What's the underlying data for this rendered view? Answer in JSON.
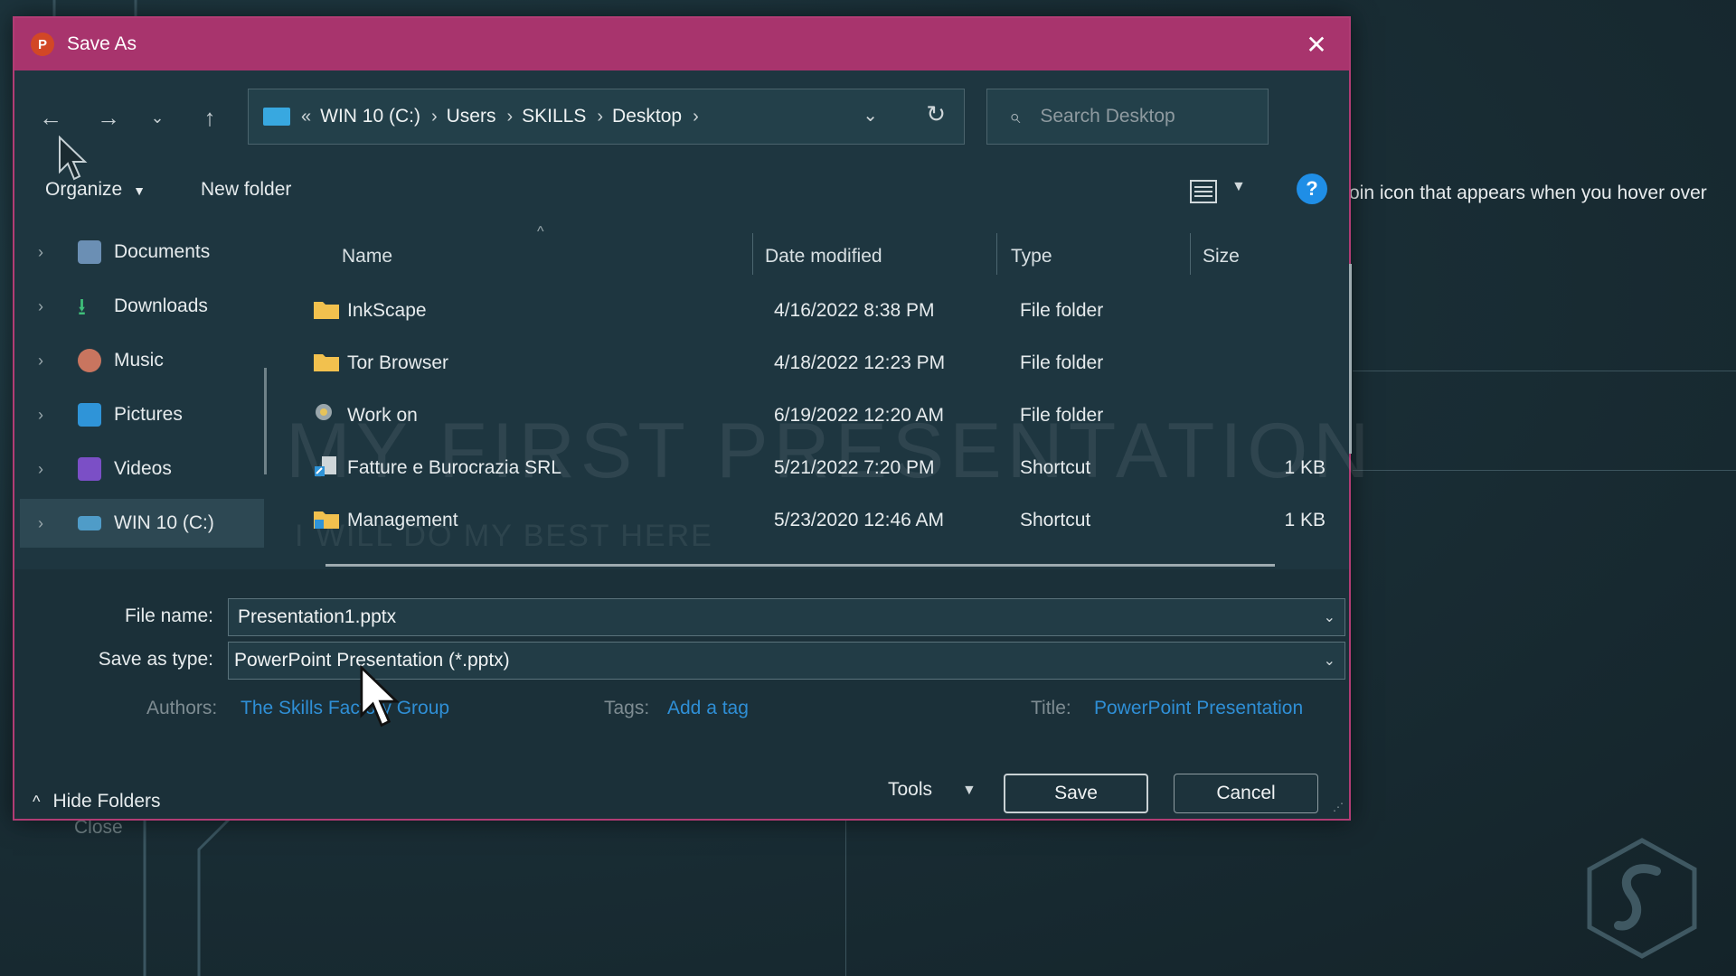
{
  "background": {
    "side_text": "oin icon that appears when you hover over",
    "close_label": "Close"
  },
  "dialog": {
    "title": "Save As",
    "app_icon_letter": "P",
    "accent": "#a8346d"
  },
  "address": {
    "root_chevrons": "«",
    "crumbs": [
      "WIN 10 (C:)",
      "Users",
      "SKILLS",
      "Desktop"
    ],
    "separator": "›"
  },
  "search": {
    "placeholder": "Search Desktop"
  },
  "toolbar": {
    "organize": "Organize",
    "new_folder": "New folder",
    "help": "?"
  },
  "nav": {
    "items": [
      {
        "label": "Documents",
        "icon": "documents-icon"
      },
      {
        "label": "Downloads",
        "icon": "downloads-icon"
      },
      {
        "label": "Music",
        "icon": "music-icon"
      },
      {
        "label": "Pictures",
        "icon": "pictures-icon"
      },
      {
        "label": "Videos",
        "icon": "videos-icon"
      },
      {
        "label": "WIN 10 (C:)",
        "icon": "drive-icon"
      }
    ]
  },
  "columns": {
    "name": "Name",
    "date": "Date modified",
    "type": "Type",
    "size": "Size"
  },
  "files": [
    {
      "name": "InkScape",
      "date": "4/16/2022 8:38 PM",
      "type": "File folder",
      "size": ""
    },
    {
      "name": "Tor Browser",
      "date": "4/18/2022 12:23 PM",
      "type": "File folder",
      "size": ""
    },
    {
      "name": "Work on",
      "date": "6/19/2022 12:20 AM",
      "type": "File folder",
      "size": ""
    },
    {
      "name": "Fatture e Burocrazia SRL",
      "date": "5/21/2022 7:20 PM",
      "type": "Shortcut",
      "size": "1 KB"
    },
    {
      "name": "Management",
      "date": "5/23/2020 12:46 AM",
      "type": "Shortcut",
      "size": "1 KB"
    }
  ],
  "watermark": {
    "line1": "MY FIRST PRESENTATION",
    "line2": "I WILL DO MY BEST HERE"
  },
  "form": {
    "file_name_label": "File name:",
    "file_name_value": "Presentation1.pptx",
    "type_label": "Save as type:",
    "type_value": "PowerPoint Presentation (*.pptx)",
    "authors_label": "Authors:",
    "authors_value": "The Skills Factory Group",
    "tags_label": "Tags:",
    "tags_value": "Add a tag",
    "title_label": "Title:",
    "title_value": "PowerPoint Presentation"
  },
  "footer": {
    "hide_folders": "Hide Folders",
    "tools": "Tools",
    "save": "Save",
    "cancel": "Cancel"
  }
}
